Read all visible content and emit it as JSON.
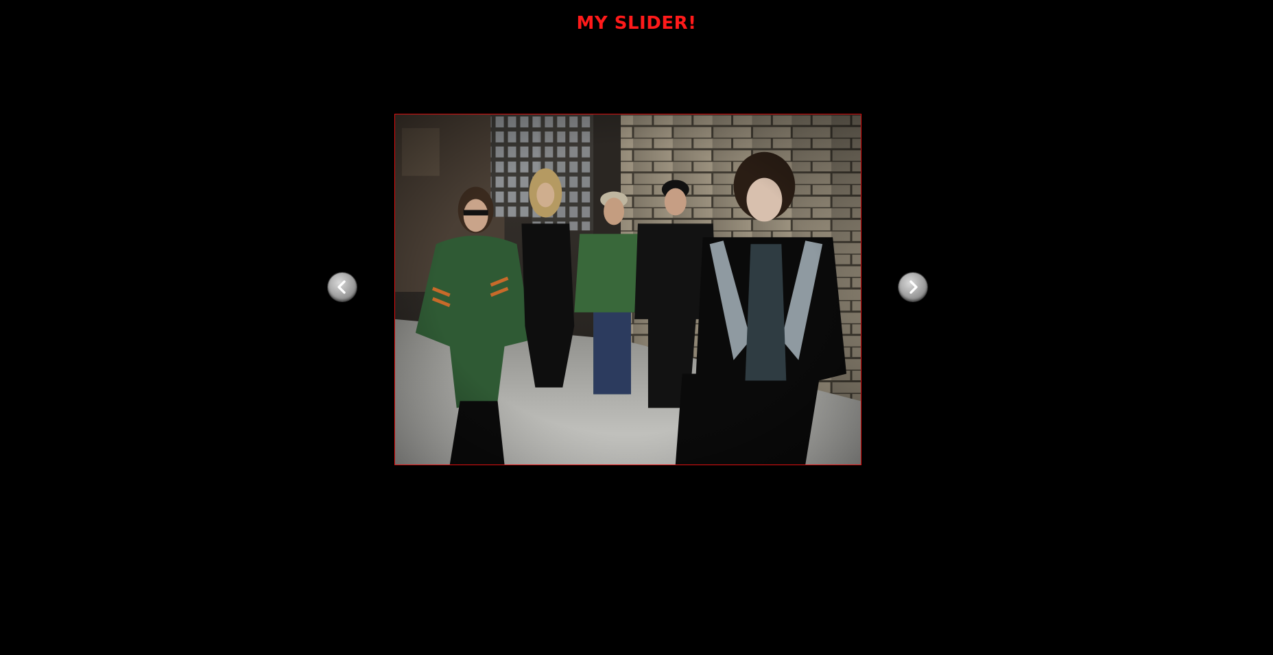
{
  "page": {
    "title": "MY SLIDER!"
  },
  "slider": {
    "prev_icon": "chevron-left-icon",
    "next_icon": "chevron-right-icon",
    "current_slide": {
      "image": "band-photo"
    }
  },
  "colors": {
    "background": "#000000",
    "title": "#ff1a1a",
    "slide_border": "#e01010",
    "nav_button": "#a9a9a9"
  }
}
